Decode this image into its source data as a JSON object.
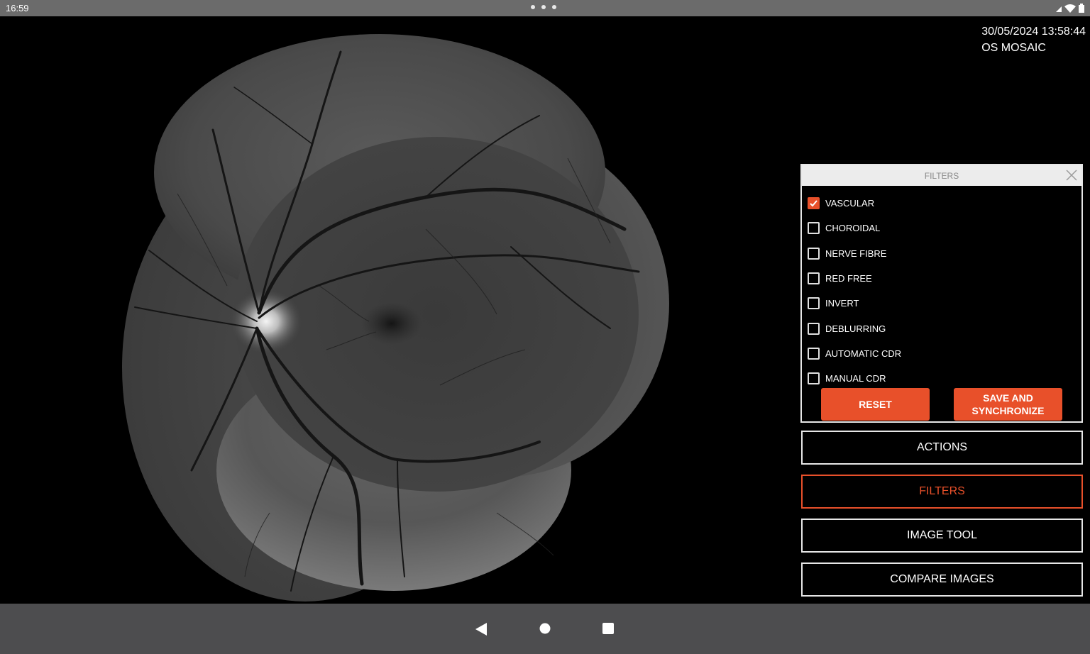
{
  "status_bar": {
    "time": "16:59",
    "icons": [
      "dots-icon",
      "signal-icon",
      "wifi-icon",
      "battery-icon"
    ]
  },
  "capture": {
    "datetime": "30/05/2024 13:58:44",
    "label": "OS MOSAIC"
  },
  "filters_panel": {
    "title": "FILTERS",
    "close_icon": "close-icon",
    "items": [
      {
        "label": "VASCULAR",
        "checked": true
      },
      {
        "label": "CHOROIDAL",
        "checked": false
      },
      {
        "label": "NERVE FIBRE",
        "checked": false
      },
      {
        "label": "RED FREE",
        "checked": false
      },
      {
        "label": "INVERT",
        "checked": false
      },
      {
        "label": "DEBLURRING",
        "checked": false
      },
      {
        "label": "AUTOMATIC CDR",
        "checked": false
      },
      {
        "label": "MANUAL CDR",
        "checked": false
      }
    ],
    "reset_label": "RESET",
    "save_label_line1": "SAVE AND",
    "save_label_line2": "SYNCHRONIZE"
  },
  "menu": {
    "actions": "ACTIONS",
    "filters": "FILTERS",
    "image_tool": "IMAGE TOOL",
    "compare_images": "COMPARE IMAGES",
    "active": "filters"
  },
  "nav_bar": {
    "icons": [
      "back-icon",
      "home-icon",
      "recents-icon"
    ]
  },
  "colors": {
    "accent": "#e8502a",
    "status_bar": "#6b6b6b",
    "nav_bar": "#4d4d4f",
    "panel_border": "#e6e6e6"
  }
}
